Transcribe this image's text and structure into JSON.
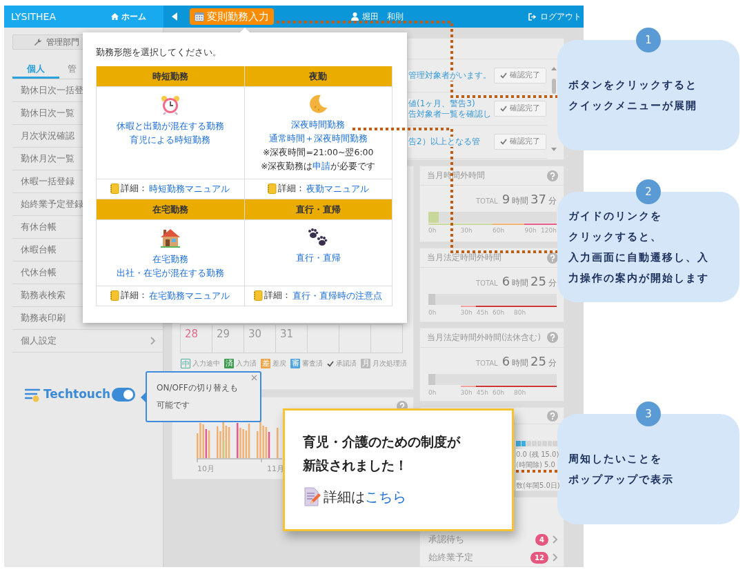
{
  "navbar": {
    "brand": "LYSITHEA",
    "home": "ホーム",
    "quick_button": "変則勤務入力",
    "user": "堀田　和則",
    "logout": "ログアウト"
  },
  "sidebar": {
    "dept_button": "管理部門",
    "tabs": [
      {
        "label": "個人",
        "selected": true
      },
      {
        "label": "管",
        "selected": false
      }
    ],
    "items": [
      {
        "label": "勤休日次一括登"
      },
      {
        "label": "勤休日次一覧"
      },
      {
        "label": "月次状況確認"
      },
      {
        "label": "勤休月次一覧"
      },
      {
        "label": "休暇一括登録"
      },
      {
        "label": "始終業予定登録"
      },
      {
        "label": "有休台帳"
      },
      {
        "label": "休暇台帳"
      },
      {
        "label": "代休台帳"
      },
      {
        "label": "勤務表検索"
      },
      {
        "label": "勤務表印刷"
      },
      {
        "label": "個人設定",
        "arrow": true
      }
    ]
  },
  "techtouch": {
    "logo": "Techtouch",
    "on": true,
    "tooltip": [
      "ON/OFFの切り替えも",
      "可能です"
    ]
  },
  "notices": [
    {
      "lines": [
        "管理対象者がいます。"
      ],
      "button": "確認完了"
    },
    {
      "lines": [
        "値(1ヶ月、警告3)",
        "告対象者一覧を確認し"
      ],
      "button": "確認完了"
    },
    {
      "lines": [
        "告2）以上となる管"
      ],
      "button": "確認完了"
    }
  ],
  "calendar": {
    "days": [
      {
        "label": "28",
        "holiday": true
      },
      {
        "label": "29",
        "holiday": false
      },
      {
        "label": "30",
        "holiday": false
      },
      {
        "label": "31",
        "holiday": false
      }
    ],
    "legend": [
      {
        "kind": "outline",
        "mark": "中",
        "label": "入力途中",
        "color": "#4fae9a"
      },
      {
        "kind": "filled",
        "mark": "済",
        "label": "入力済",
        "color": "#3f9b4f"
      },
      {
        "kind": "filled",
        "mark": "差",
        "label": "差戻",
        "color": "#eea54a"
      },
      {
        "kind": "filled",
        "mark": "審",
        "label": "審査済",
        "color": "#4fa4e4"
      },
      {
        "kind": "check",
        "label": "承認済",
        "color": "#555555"
      },
      {
        "kind": "filled",
        "mark": "月",
        "label": "月次処理済",
        "color": "#bbbbbb"
      }
    ]
  },
  "chart": {
    "month_labels": [
      "10月",
      "11月"
    ]
  },
  "overtime": [
    {
      "title": "当月時間外時間",
      "total_label": "TOTAL",
      "hours": "9",
      "hours_unit": "時間",
      "minutes": "37",
      "minutes_unit": "分",
      "level": 0.08,
      "color": "#c8d89a",
      "ticks": [
        "0h",
        "30h",
        "60h",
        "90h",
        "120h"
      ]
    },
    {
      "title": "当月法定時間外時間",
      "total_label": "TOTAL",
      "hours": "6",
      "hours_unit": "時間",
      "minutes": "25",
      "minutes_unit": "分",
      "level": 0.053,
      "color": "#c9c9c9",
      "ticks": [
        "0h",
        "30h",
        "45h",
        "60h",
        "80h"
      ]
    },
    {
      "title": "当月法定時間外時間(法休含む)",
      "total_label": "TOTAL",
      "hours": "6",
      "hours_unit": "時間",
      "minutes": "25",
      "minutes_unit": "分",
      "level": 0.053,
      "color": "#c9c9c9",
      "ticks": [
        "0h",
        "30h",
        "45h",
        "60h",
        "80h"
      ]
    }
  ],
  "leave": {
    "level": 0.25,
    "lines": [
      "0.0 (残 15.0)",
      "(時間除) 5.0",
      "数(年間5.0日)"
    ]
  },
  "counts": [
    {
      "label": "承認待ち",
      "count": "4"
    },
    {
      "label": "始終業予定",
      "count": "12"
    }
  ],
  "quick_menu": {
    "prompt": "勤務形態を選択してください。",
    "options": [
      {
        "title": "時短勤務",
        "links": [
          "休暇と出勤が混在する勤務",
          "育児による時短勤務"
        ],
        "detail_label": "詳細：",
        "detail_link": "時短勤務マニュアル"
      },
      {
        "title": "夜勤",
        "links": [
          "深夜時間勤務",
          "通常時間＋深夜時間勤務"
        ],
        "notes": [
          {
            "text": "※深夜時間=21:00~翌6:00"
          },
          {
            "before": "※深夜勤務は",
            "link": "申請",
            "after": "が必要です"
          }
        ],
        "detail_label": "詳細：",
        "detail_link": "夜勤マニュアル"
      },
      {
        "title": "在宅勤務",
        "links": [
          "在宅勤務",
          "出社・在宅が混在する勤務"
        ],
        "detail_label": "詳細：",
        "detail_link": "在宅勤務マニュアル"
      },
      {
        "title": "直行・直帰",
        "links": [
          "直行・直帰"
        ],
        "detail_label": "詳細：",
        "detail_link": "直行・直帰時の注意点"
      }
    ]
  },
  "announcement": {
    "title_lines": [
      "育児・介護のための制度が",
      "新設されました！"
    ],
    "detail_label": "詳細は",
    "detail_link": "こちら"
  },
  "callouts": [
    {
      "number": "1",
      "lines": [
        "ボタンをクリックすると",
        "クイックメニューが展開"
      ]
    },
    {
      "number": "2",
      "lines": [
        "ガイドのリンクを",
        "クリックすると、",
        "入力画面に自動遷移し、入",
        "力操作の案内が開始します"
      ]
    },
    {
      "number": "3",
      "lines": [
        "周知したいことを",
        "ポップアップで表示"
      ]
    }
  ]
}
